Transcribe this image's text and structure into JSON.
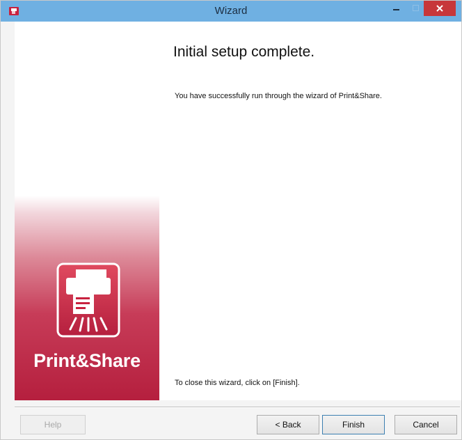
{
  "window": {
    "title": "Wizard"
  },
  "titlebar": {
    "app_icon": "app-icon",
    "minimize_icon": "minimize-icon",
    "maximize_icon": "maximize-icon",
    "close_icon": "close-icon"
  },
  "banner": {
    "brand": "Print&Share",
    "icon": "print-share-logo-icon"
  },
  "main": {
    "heading": "Initial setup complete.",
    "message": "You have successfully run through the wizard of Print&Share.",
    "footer": "To close this wizard, click on [Finish]."
  },
  "buttons": {
    "help": "Help",
    "back": "< Back",
    "finish": "Finish",
    "cancel": "Cancel"
  },
  "colors": {
    "titlebar": "#6fb0e2",
    "close": "#c7373a",
    "brand_red": "#b51f3e"
  }
}
